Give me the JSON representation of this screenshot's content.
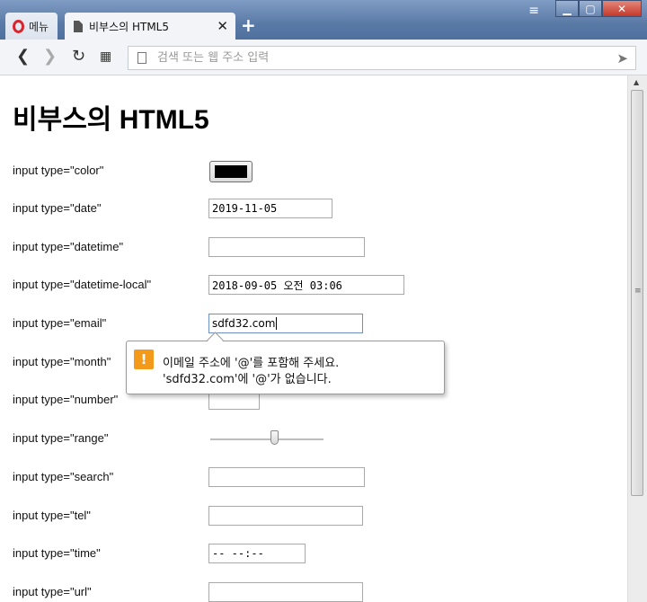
{
  "browser": {
    "menu_label": "메뉴",
    "tab_title": "비부스의 HTML5",
    "tab_close": "✕",
    "new_tab": "+",
    "address_placeholder": "검색 또는 웹 주소 입력"
  },
  "page": {
    "title": "비부스의 HTML5",
    "rows": [
      {
        "label": "input type=\"color\"",
        "value": "#000000"
      },
      {
        "label": "input type=\"date\"",
        "value": "2019-11-05"
      },
      {
        "label": "input type=\"datetime\"",
        "value": ""
      },
      {
        "label": "input type=\"datetime-local\"",
        "value": "2018-09-05 오전 03:06"
      },
      {
        "label": "input type=\"email\"",
        "value": "sdfd32.com"
      },
      {
        "label": "input type=\"month\"",
        "value": ""
      },
      {
        "label": "input type=\"number\"",
        "value": ""
      },
      {
        "label": "input type=\"range\"",
        "value": 0.57
      },
      {
        "label": "input type=\"search\"",
        "value": ""
      },
      {
        "label": "input type=\"tel\"",
        "value": ""
      },
      {
        "label": "input type=\"time\"",
        "value": "-- --:--"
      },
      {
        "label": "input type=\"url\"",
        "value": ""
      }
    ]
  },
  "validation_tooltip": {
    "line1": "이메일 주소에 '@'를 포함해 주세요.",
    "line2": "'sdfd32.com'에 '@'가 없습니다."
  }
}
